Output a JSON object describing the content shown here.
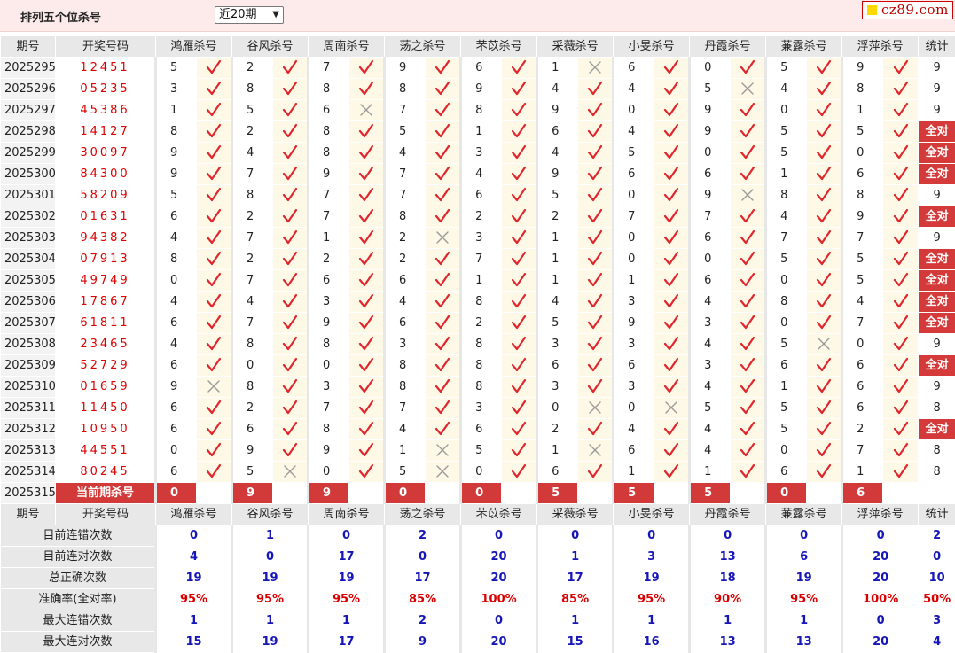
{
  "header": {
    "title": "排列五个位杀号",
    "period_select": "近20期",
    "logo": "cz89.com"
  },
  "columns": {
    "issue": "期号",
    "draw": "开奖号码",
    "experts": [
      "鸿雁杀号",
      "谷风杀号",
      "周南杀号",
      "荡之杀号",
      "芣苡杀号",
      "采薇杀号",
      "小旻杀号",
      "丹霞杀号",
      "蒹露杀号",
      "浮萍杀号"
    ],
    "stat": "统计"
  },
  "rows": [
    {
      "issue": "2025295",
      "draw": "12451",
      "kills": [
        "5",
        "2",
        "7",
        "9",
        "6",
        "1",
        "6",
        "0",
        "5",
        "9"
      ],
      "hits": [
        1,
        1,
        1,
        1,
        1,
        0,
        1,
        1,
        1,
        1
      ],
      "stat": "9"
    },
    {
      "issue": "2025296",
      "draw": "05235",
      "kills": [
        "3",
        "8",
        "8",
        "8",
        "9",
        "4",
        "4",
        "5",
        "4",
        "8"
      ],
      "hits": [
        1,
        1,
        1,
        1,
        1,
        1,
        1,
        0,
        1,
        1
      ],
      "stat": "9"
    },
    {
      "issue": "2025297",
      "draw": "45386",
      "kills": [
        "1",
        "5",
        "6",
        "7",
        "8",
        "9",
        "0",
        "9",
        "0",
        "1"
      ],
      "hits": [
        1,
        1,
        0,
        1,
        1,
        1,
        1,
        1,
        1,
        1
      ],
      "stat": "9"
    },
    {
      "issue": "2025298",
      "draw": "14127",
      "kills": [
        "8",
        "2",
        "8",
        "5",
        "1",
        "6",
        "4",
        "9",
        "5",
        "5"
      ],
      "hits": [
        1,
        1,
        1,
        1,
        1,
        1,
        1,
        1,
        1,
        1
      ],
      "stat": "全对"
    },
    {
      "issue": "2025299",
      "draw": "30097",
      "kills": [
        "9",
        "4",
        "8",
        "4",
        "3",
        "4",
        "5",
        "0",
        "5",
        "0"
      ],
      "hits": [
        1,
        1,
        1,
        1,
        1,
        1,
        1,
        1,
        1,
        1
      ],
      "stat": "全对"
    },
    {
      "issue": "2025300",
      "draw": "84300",
      "kills": [
        "9",
        "7",
        "9",
        "7",
        "4",
        "9",
        "6",
        "6",
        "1",
        "6"
      ],
      "hits": [
        1,
        1,
        1,
        1,
        1,
        1,
        1,
        1,
        1,
        1
      ],
      "stat": "全对"
    },
    {
      "issue": "2025301",
      "draw": "58209",
      "kills": [
        "5",
        "8",
        "7",
        "7",
        "6",
        "5",
        "0",
        "9",
        "8",
        "8"
      ],
      "hits": [
        1,
        1,
        1,
        1,
        1,
        1,
        1,
        0,
        1,
        1
      ],
      "stat": "9"
    },
    {
      "issue": "2025302",
      "draw": "01631",
      "kills": [
        "6",
        "2",
        "7",
        "8",
        "2",
        "2",
        "7",
        "7",
        "4",
        "9"
      ],
      "hits": [
        1,
        1,
        1,
        1,
        1,
        1,
        1,
        1,
        1,
        1
      ],
      "stat": "全对"
    },
    {
      "issue": "2025303",
      "draw": "94382",
      "kills": [
        "4",
        "7",
        "1",
        "2",
        "3",
        "1",
        "0",
        "6",
        "7",
        "7"
      ],
      "hits": [
        1,
        1,
        1,
        0,
        1,
        1,
        1,
        1,
        1,
        1
      ],
      "stat": "9"
    },
    {
      "issue": "2025304",
      "draw": "07913",
      "kills": [
        "8",
        "2",
        "2",
        "2",
        "7",
        "1",
        "0",
        "0",
        "5",
        "5"
      ],
      "hits": [
        1,
        1,
        1,
        1,
        1,
        1,
        1,
        1,
        1,
        1
      ],
      "stat": "全对"
    },
    {
      "issue": "2025305",
      "draw": "49749",
      "kills": [
        "0",
        "7",
        "6",
        "6",
        "1",
        "1",
        "1",
        "6",
        "0",
        "5"
      ],
      "hits": [
        1,
        1,
        1,
        1,
        1,
        1,
        1,
        1,
        1,
        1
      ],
      "stat": "全对"
    },
    {
      "issue": "2025306",
      "draw": "17867",
      "kills": [
        "4",
        "4",
        "3",
        "4",
        "8",
        "4",
        "3",
        "4",
        "8",
        "4"
      ],
      "hits": [
        1,
        1,
        1,
        1,
        1,
        1,
        1,
        1,
        1,
        1
      ],
      "stat": "全对"
    },
    {
      "issue": "2025307",
      "draw": "61811",
      "kills": [
        "6",
        "7",
        "9",
        "6",
        "2",
        "5",
        "9",
        "3",
        "0",
        "7"
      ],
      "hits": [
        1,
        1,
        1,
        1,
        1,
        1,
        1,
        1,
        1,
        1
      ],
      "stat": "全对"
    },
    {
      "issue": "2025308",
      "draw": "23465",
      "kills": [
        "4",
        "8",
        "8",
        "3",
        "8",
        "3",
        "3",
        "4",
        "5",
        "0"
      ],
      "hits": [
        1,
        1,
        1,
        1,
        1,
        1,
        1,
        1,
        0,
        1
      ],
      "stat": "9"
    },
    {
      "issue": "2025309",
      "draw": "52729",
      "kills": [
        "6",
        "0",
        "0",
        "8",
        "8",
        "6",
        "6",
        "3",
        "6",
        "6"
      ],
      "hits": [
        1,
        1,
        1,
        1,
        1,
        1,
        1,
        1,
        1,
        1
      ],
      "stat": "全对"
    },
    {
      "issue": "2025310",
      "draw": "01659",
      "kills": [
        "9",
        "8",
        "3",
        "8",
        "8",
        "3",
        "3",
        "4",
        "1",
        "6"
      ],
      "hits": [
        0,
        1,
        1,
        1,
        1,
        1,
        1,
        1,
        1,
        1
      ],
      "stat": "9"
    },
    {
      "issue": "2025311",
      "draw": "11450",
      "kills": [
        "6",
        "2",
        "7",
        "7",
        "3",
        "0",
        "0",
        "5",
        "5",
        "6"
      ],
      "hits": [
        1,
        1,
        1,
        1,
        1,
        0,
        0,
        1,
        1,
        1
      ],
      "stat": "8"
    },
    {
      "issue": "2025312",
      "draw": "10950",
      "kills": [
        "6",
        "6",
        "8",
        "4",
        "6",
        "2",
        "4",
        "4",
        "5",
        "2"
      ],
      "hits": [
        1,
        1,
        1,
        1,
        1,
        1,
        1,
        1,
        1,
        1
      ],
      "stat": "全对"
    },
    {
      "issue": "2025313",
      "draw": "44551",
      "kills": [
        "0",
        "9",
        "9",
        "1",
        "5",
        "1",
        "6",
        "4",
        "0",
        "7"
      ],
      "hits": [
        1,
        1,
        1,
        0,
        1,
        0,
        1,
        1,
        1,
        1
      ],
      "stat": "8"
    },
    {
      "issue": "2025314",
      "draw": "80245",
      "kills": [
        "6",
        "5",
        "0",
        "5",
        "0",
        "6",
        "1",
        "1",
        "6",
        "1"
      ],
      "hits": [
        1,
        0,
        1,
        0,
        1,
        1,
        1,
        1,
        1,
        1
      ],
      "stat": "8"
    }
  ],
  "current": {
    "issue": "2025315",
    "label": "当前期杀号",
    "kills": [
      "0",
      "9",
      "9",
      "0",
      "0",
      "5",
      "5",
      "5",
      "0",
      "6"
    ]
  },
  "summary": [
    {
      "label": "目前连错次数",
      "values": [
        "0",
        "1",
        "0",
        "2",
        "0",
        "0",
        "0",
        "0",
        "0",
        "0"
      ],
      "stat": "2",
      "rate": false
    },
    {
      "label": "目前连对次数",
      "values": [
        "4",
        "0",
        "17",
        "0",
        "20",
        "1",
        "3",
        "13",
        "6",
        "20"
      ],
      "stat": "0",
      "rate": false
    },
    {
      "label": "总正确次数",
      "values": [
        "19",
        "19",
        "19",
        "17",
        "20",
        "17",
        "19",
        "18",
        "19",
        "20"
      ],
      "stat": "10",
      "rate": false
    },
    {
      "label": "准确率(全对率)",
      "values": [
        "95%",
        "95%",
        "95%",
        "85%",
        "100%",
        "85%",
        "95%",
        "90%",
        "95%",
        "100%"
      ],
      "stat": "50%",
      "rate": true
    },
    {
      "label": "最大连错次数",
      "values": [
        "1",
        "1",
        "1",
        "2",
        "0",
        "1",
        "1",
        "1",
        "1",
        "0"
      ],
      "stat": "3",
      "rate": false
    },
    {
      "label": "最大连对次数",
      "values": [
        "15",
        "19",
        "17",
        "9",
        "20",
        "15",
        "16",
        "13",
        "13",
        "20"
      ],
      "stat": "4",
      "rate": false
    }
  ],
  "icons": {
    "hit": "check-icon",
    "miss": "cross-icon"
  },
  "colors": {
    "accent_red": "#d43a3a",
    "draw_red": "#dd0000",
    "stat_blue": "#1515b8",
    "mark_bg": "#fdf9e6",
    "header_bg": "#e8e8e8"
  }
}
